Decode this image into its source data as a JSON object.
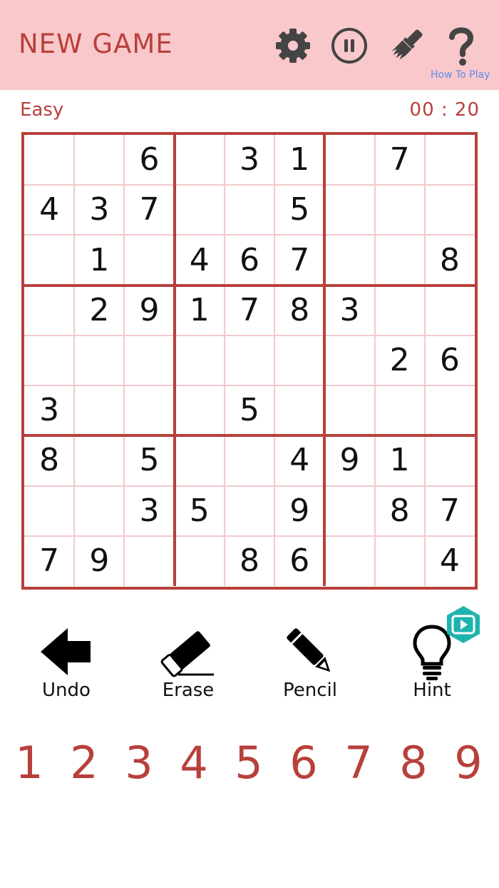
{
  "header": {
    "new_game_label": "NEW GAME",
    "how_to_play_label": "How To Play"
  },
  "status": {
    "difficulty": "Easy",
    "timer": "00 : 20"
  },
  "board": {
    "grid": [
      [
        "",
        "",
        "6",
        "",
        "3",
        "1",
        "",
        "7",
        ""
      ],
      [
        "4",
        "3",
        "7",
        "",
        "",
        "5",
        "",
        "",
        ""
      ],
      [
        "",
        "1",
        "",
        "4",
        "6",
        "7",
        "",
        "",
        "8"
      ],
      [
        "",
        "2",
        "9",
        "1",
        "7",
        "8",
        "3",
        "",
        ""
      ],
      [
        "",
        "",
        "",
        "",
        "",
        "",
        "",
        "2",
        "6"
      ],
      [
        "3",
        "",
        "",
        "",
        "5",
        "",
        "",
        "",
        ""
      ],
      [
        "8",
        "",
        "5",
        "",
        "",
        "4",
        "9",
        "1",
        ""
      ],
      [
        "",
        "",
        "3",
        "5",
        "",
        "9",
        "",
        "8",
        "7"
      ],
      [
        "7",
        "9",
        "",
        "",
        "8",
        "6",
        "",
        "",
        "4"
      ]
    ]
  },
  "tools": {
    "undo_label": "Undo",
    "erase_label": "Erase",
    "pencil_label": "Pencil",
    "hint_label": "Hint"
  },
  "numpad": [
    "1",
    "2",
    "3",
    "4",
    "5",
    "6",
    "7",
    "8",
    "9"
  ],
  "colors": {
    "header_bg": "#f9c8cb",
    "accent": "#b8403b",
    "thin_grid": "#f4c9cc",
    "link": "#5b8dee",
    "hint_badge": "#1fb3ad"
  }
}
